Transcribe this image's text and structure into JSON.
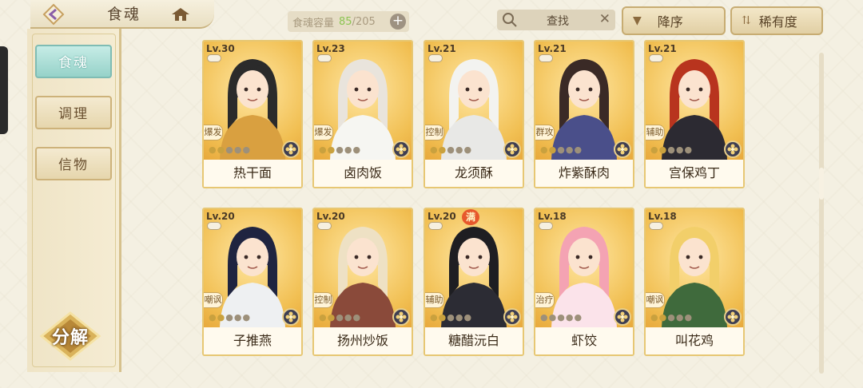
{
  "header": {
    "title": "食魂",
    "capacity_label": "食魂容量",
    "capacity_current": "85",
    "capacity_max": "/205",
    "capacity_add": "+",
    "search_label": "查找",
    "search_clear": "✕",
    "sort_order_label": "降序",
    "sort_order_icon": "▼",
    "sort_key_label": "稀有度",
    "sort_key_icon": "⇅"
  },
  "sidebar": {
    "tabs": [
      {
        "label": "食魂",
        "active": true
      },
      {
        "label": "调理",
        "active": false
      },
      {
        "label": "信物",
        "active": false
      }
    ],
    "decompose_label": "分解"
  },
  "cards": [
    {
      "level": "Lv.30",
      "role": "爆发",
      "name": "热干面",
      "stars": 2,
      "full": "",
      "hair": "#2b2b2b",
      "robe": "#d9a040"
    },
    {
      "level": "Lv.23",
      "role": "爆发",
      "name": "卤肉饭",
      "stars": 2,
      "full": "",
      "hair": "#e9e4dc",
      "robe": "#f6f6f2"
    },
    {
      "level": "Lv.21",
      "role": "控制",
      "name": "龙须酥",
      "stars": 2,
      "full": "",
      "hair": "#f3f3f0",
      "robe": "#e8e8e6"
    },
    {
      "level": "Lv.21",
      "role": "群攻",
      "name": "炸紫酥肉",
      "stars": 2,
      "full": "",
      "hair": "#3a2a26",
      "robe": "#4a4f8a"
    },
    {
      "level": "Lv.21",
      "role": "辅助",
      "name": "宫保鸡丁",
      "stars": 2,
      "full": "",
      "hair": "#b8341e",
      "robe": "#2c2a32"
    },
    {
      "level": "Lv.20",
      "role": "嘲讽",
      "name": "子推燕",
      "stars": 2,
      "full": "",
      "hair": "#1f2440",
      "robe": "#eef0f2"
    },
    {
      "level": "Lv.20",
      "role": "控制",
      "name": "扬州炒饭",
      "stars": 2,
      "full": "",
      "hair": "#eee1c4",
      "robe": "#8a4a3a"
    },
    {
      "level": "Lv.20",
      "role": "辅助",
      "name": "糖醋沅白",
      "stars": 2,
      "full": "满",
      "hair": "#1e1e22",
      "robe": "#2c2c34"
    },
    {
      "level": "Lv.18",
      "role": "治疗",
      "name": "虾饺",
      "stars": 0,
      "full": "",
      "hair": "#f4a3b3",
      "robe": "#fbe3ea"
    },
    {
      "level": "Lv.18",
      "role": "嘲讽",
      "name": "叫花鸡",
      "stars": 2,
      "full": "",
      "hair": "#f2cf6a",
      "robe": "#3f6a3c"
    }
  ],
  "colors": {
    "accent_teal": "#96d2c9",
    "gold_border": "#e7c773",
    "capacity_current": "#8cc552"
  }
}
